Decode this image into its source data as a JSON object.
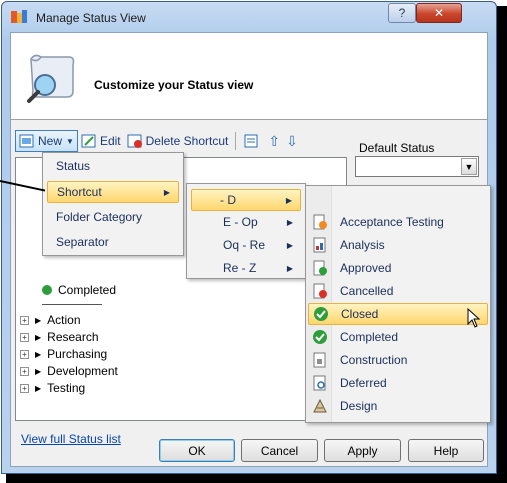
{
  "window": {
    "title": "Manage Status View",
    "help_glyph": "?",
    "close_glyph": "✕"
  },
  "header": {
    "title": "Customize your Status view"
  },
  "toolbar": {
    "new_label": "New",
    "edit_label": "Edit",
    "delete_label": "Delete Shortcut"
  },
  "default_status": {
    "label": "Default Status",
    "value": ""
  },
  "tree": {
    "partial_item": "Completed",
    "items": [
      "Action",
      "Research",
      "Purchasing",
      "Development",
      "Testing"
    ]
  },
  "new_menu": {
    "items": [
      "Status",
      "Shortcut",
      "Folder Category",
      "Separator"
    ]
  },
  "shortcut_menu": {
    "items": [
      "- D",
      "E - Op",
      "Oq - Re",
      "Re - Z"
    ]
  },
  "status_menu": {
    "items": [
      {
        "label": "Acceptance Testing",
        "icon": "acceptance-icon"
      },
      {
        "label": "Analysis",
        "icon": "analysis-icon"
      },
      {
        "label": "Approved",
        "icon": "approved-icon"
      },
      {
        "label": "Cancelled",
        "icon": "cancelled-icon"
      },
      {
        "label": "Closed",
        "icon": "check-icon"
      },
      {
        "label": "Completed",
        "icon": "check-icon"
      },
      {
        "label": "Construction",
        "icon": "construction-icon"
      },
      {
        "label": "Deferred",
        "icon": "deferred-icon"
      },
      {
        "label": "Design",
        "icon": "design-icon"
      }
    ]
  },
  "links": {
    "view_full": "View full Status list"
  },
  "buttons": {
    "ok": "OK",
    "cancel": "Cancel",
    "apply": "Apply",
    "help": "Help"
  },
  "colors": {
    "highlight": "#ffd66e",
    "check_green": "#2e9e3a",
    "link": "#0645ad"
  }
}
